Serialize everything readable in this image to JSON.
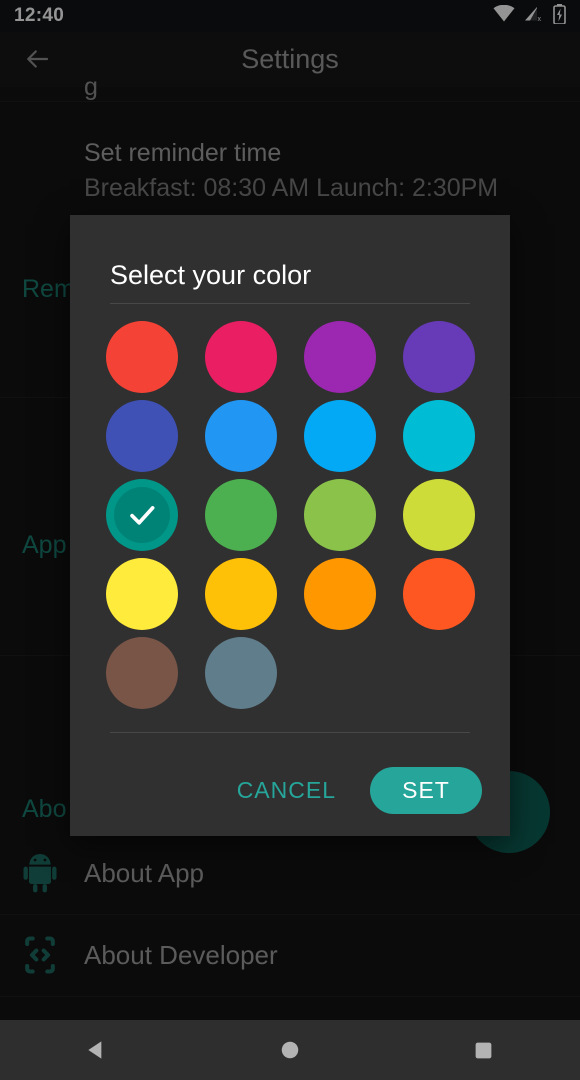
{
  "status_bar": {
    "time": "12:40",
    "icons": [
      "wifi-icon",
      "cellular-signal-no-sim-icon",
      "battery-charging-icon"
    ]
  },
  "app_bar": {
    "back_icon": "back-arrow-icon",
    "title": "Settings"
  },
  "background_settings": {
    "partial_top_text": "g",
    "reminder_pref": {
      "title": "Set reminder time",
      "summary": "Breakfast: 08:30 AM Launch: 2:30PM"
    },
    "sections": [
      {
        "label": "Rem"
      },
      {
        "label": "App"
      },
      {
        "label": "Abo"
      }
    ],
    "list_items": [
      {
        "label": "About App",
        "icon": "android-robot-icon"
      },
      {
        "label": "About Developer",
        "icon": "developer-code-phone-icon"
      }
    ],
    "fab": {
      "icon": "fab-button",
      "color": "#0d5f55"
    }
  },
  "dialog": {
    "title": "Select your color",
    "selected_index": 8,
    "swatches": [
      {
        "name": "red",
        "hex": "#F44336"
      },
      {
        "name": "pink",
        "hex": "#E91E63"
      },
      {
        "name": "purple",
        "hex": "#9C27B0"
      },
      {
        "name": "deep-purple",
        "hex": "#673AB7"
      },
      {
        "name": "indigo",
        "hex": "#3F51B5"
      },
      {
        "name": "blue",
        "hex": "#2196F3"
      },
      {
        "name": "light-blue",
        "hex": "#03A9F4"
      },
      {
        "name": "cyan",
        "hex": "#00BCD4"
      },
      {
        "name": "teal",
        "hex": "#009688"
      },
      {
        "name": "green",
        "hex": "#4CAF50"
      },
      {
        "name": "light-green",
        "hex": "#8BC34A"
      },
      {
        "name": "lime",
        "hex": "#CDDC39"
      },
      {
        "name": "yellow",
        "hex": "#FFEB3B"
      },
      {
        "name": "amber",
        "hex": "#FFC107"
      },
      {
        "name": "orange",
        "hex": "#FF9800"
      },
      {
        "name": "deep-orange",
        "hex": "#FF5722"
      },
      {
        "name": "brown",
        "hex": "#795548"
      },
      {
        "name": "blue-grey",
        "hex": "#607D8B"
      }
    ],
    "cancel_label": "CANCEL",
    "set_label": "SET",
    "accent_color": "#26a69a",
    "background_color": "#303030"
  },
  "nav_bar": {
    "back": "nav-back-icon",
    "home": "nav-home-icon",
    "recents": "nav-recents-icon"
  }
}
